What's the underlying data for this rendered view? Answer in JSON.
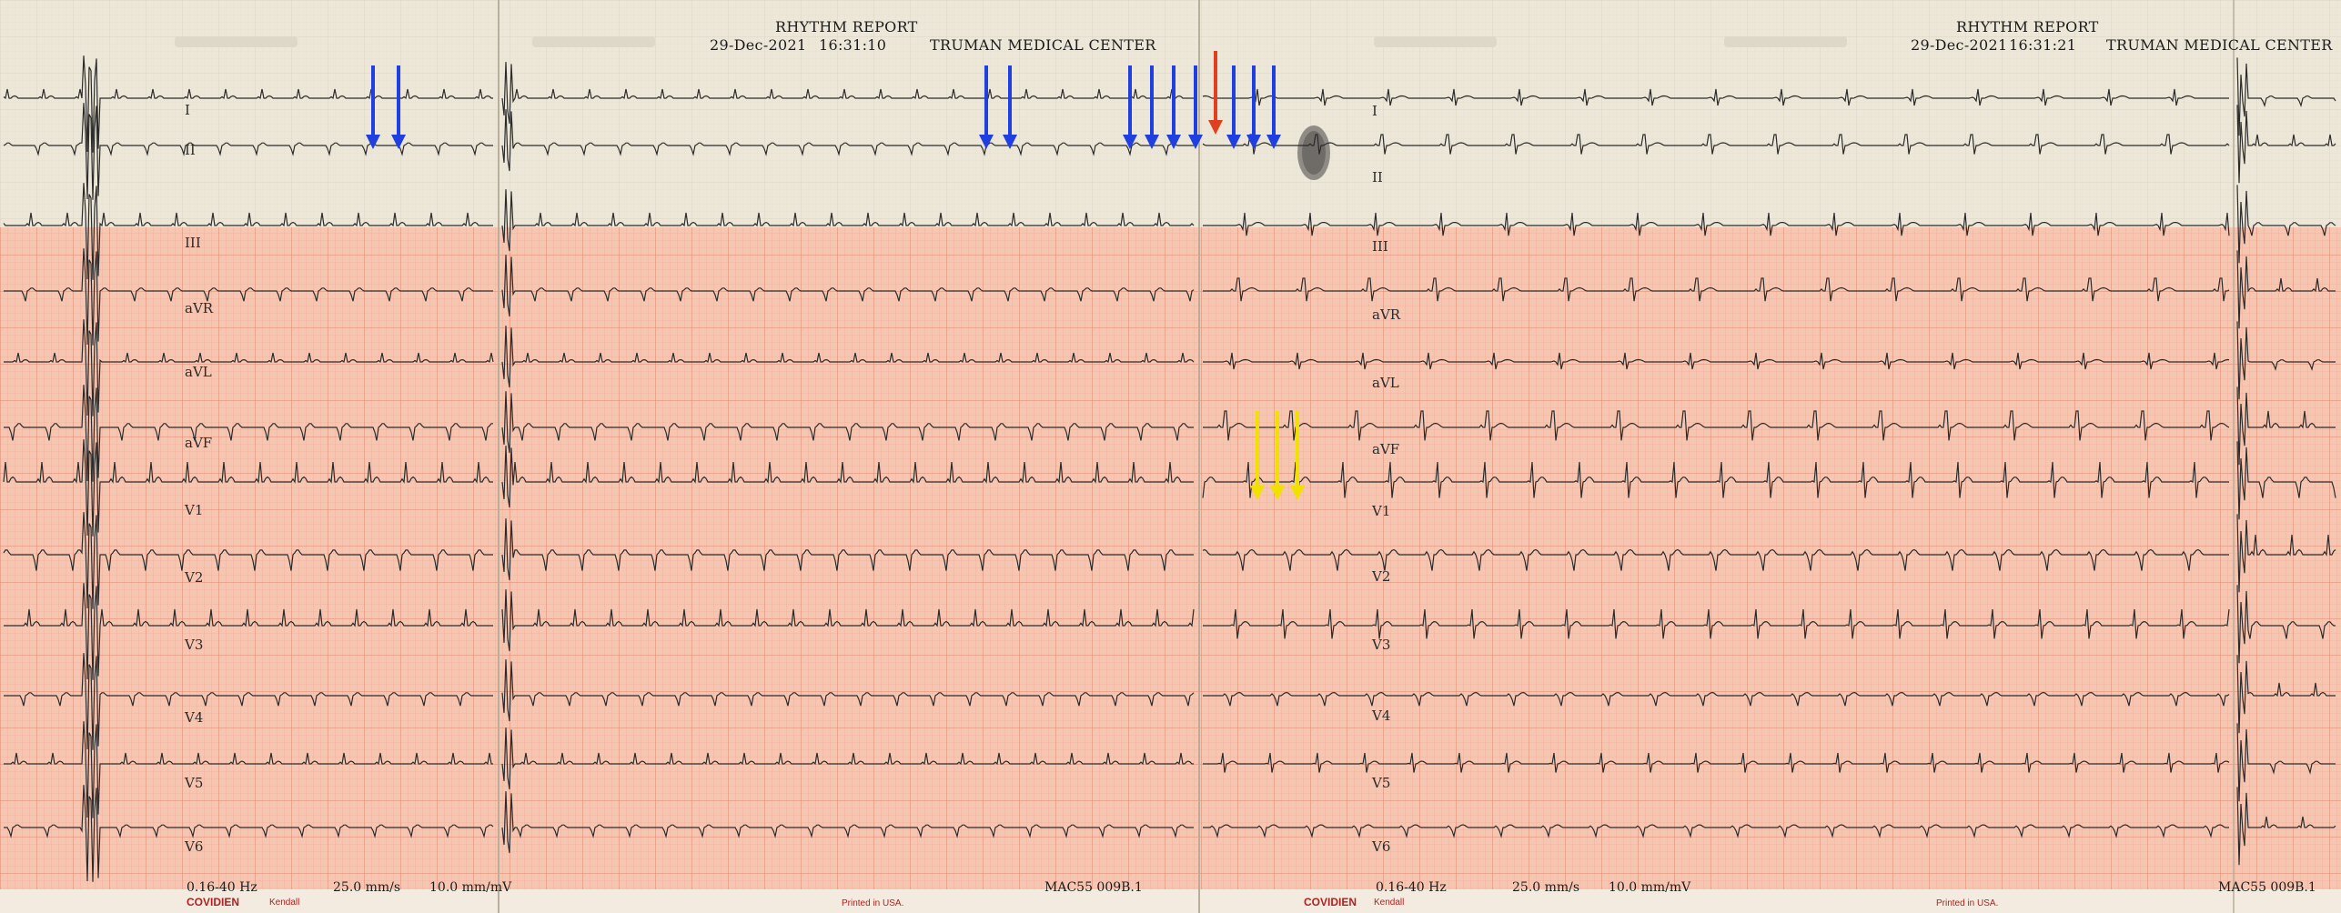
{
  "left_report": {
    "title": "RHYTHM REPORT",
    "date": "29-Dec-2021",
    "time": "16:31:10",
    "institution": "TRUMAN MEDICAL CENTER"
  },
  "right_report": {
    "title": "RHYTHM REPORT",
    "date": "29-Dec-2021",
    "time": "16:31:21",
    "institution": "TRUMAN MEDICAL CENTER"
  },
  "leads": [
    "I",
    "II",
    "III",
    "aVR",
    "aVL",
    "aVF",
    "V1",
    "V2",
    "V3",
    "V4",
    "V5",
    "V6"
  ],
  "left_footer": {
    "filter": "0.16-40 Hz",
    "speed": "25.0 mm/s",
    "gain": "10.0 mm/mV",
    "brand": "COVIDIEN",
    "brand_sub": "Kendall",
    "printed": "Printed in USA.",
    "model": "MAC55  009B.1"
  },
  "right_footer": {
    "filter": "0.16-40 Hz",
    "speed": "25.0 mm/s",
    "gain": "10.0 mm/mV",
    "brand": "COVIDIEN",
    "brand_sub": "Kendall",
    "printed": "Printed in USA.",
    "model": "MAC55  009B.1"
  },
  "annotations": {
    "blue": "#1f3fe0",
    "red": "#e0401f",
    "yellow": "#f2e000"
  },
  "colors": {
    "grid_paper": "#f4c2ae",
    "grid_line": "#e6917a",
    "upper_paper": "#ece6d6",
    "trace": "#2b2b2b"
  }
}
